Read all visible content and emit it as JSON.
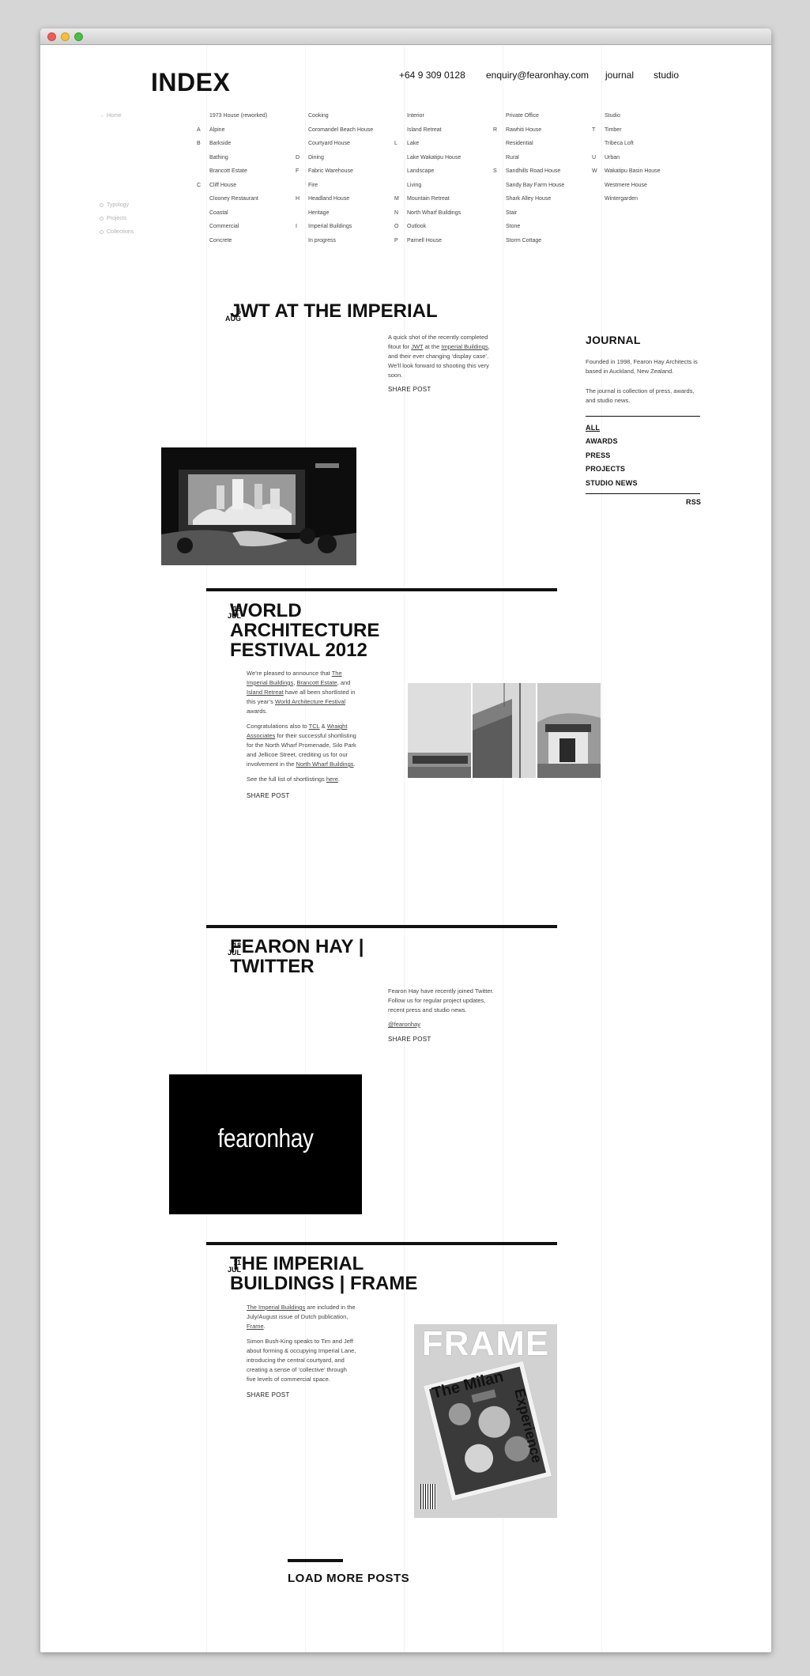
{
  "header": {
    "logo": "INDEX",
    "phone": "+64 9 309 0128",
    "email": "enquiry@fearonhay.com",
    "nav_journal": "journal",
    "nav_studio": "studio"
  },
  "sidebar": {
    "home": "Home",
    "typology": "Typology",
    "projects": "Projects",
    "collections": "Collections"
  },
  "index_columns": [
    {
      "letters": [
        "",
        "A",
        "B",
        "",
        "",
        "C",
        "",
        "",
        "",
        ""
      ],
      "items": [
        "1973 House (reworked)",
        "Alpine",
        "Barkside",
        "Bathing",
        "Brancott Estate",
        "Cliff House",
        "Clooney Restaurant",
        "Coastal",
        "Commercial",
        "Concrete"
      ]
    },
    {
      "letters": [
        "",
        "",
        "",
        "D",
        "F",
        "",
        "H",
        "",
        "I",
        ""
      ],
      "items": [
        "Cooking",
        "Coromandel Beach House",
        "Courtyard House",
        "Dining",
        "Fabric Warehouse",
        "Fire",
        "Headland House",
        "Heritage",
        "Imperial Buildings",
        "In progress"
      ]
    },
    {
      "letters": [
        "",
        "",
        "L",
        "",
        "",
        "",
        "M",
        "N",
        "O",
        "P"
      ],
      "items": [
        "Interior",
        "Island Retreat",
        "Lake",
        "Lake Wakatipu House",
        "Landscape",
        "Living",
        "Mountain Retreat",
        "North Wharf Buildings",
        "Outlook",
        "Parnell House"
      ]
    },
    {
      "letters": [
        "",
        "R",
        "",
        "",
        "S",
        "",
        "",
        "",
        "",
        ""
      ],
      "items": [
        "Private Office",
        "Rawhiti House",
        "Residential",
        "Rural",
        "Sandhills Road House",
        "Sandy Bay Farm House",
        "Shark Alley House",
        "Stair",
        "Stone",
        "Storm Cottage"
      ]
    },
    {
      "letters": [
        "",
        "T",
        "",
        "U",
        "W",
        "",
        "",
        ""
      ],
      "items": [
        "Studio",
        "Timber",
        "Tribeca Loft",
        "Urban",
        "Wakatipu Basin House",
        "Westmere House",
        "Wintergarden"
      ]
    }
  ],
  "journal": {
    "title": "JOURNAL",
    "desc1": "Founded in 1998, Fearon Hay Architects is based in Auckland, New Zealand.",
    "desc2": "The journal is collection of press, awards, and studio news.",
    "categories": [
      "ALL",
      "AWARDS",
      "PRESS",
      "PROJECTS",
      "STUDIO NEWS"
    ],
    "rss": "RSS"
  },
  "posts": [
    {
      "day": "5",
      "month": "AUG",
      "title": "JWT AT THE IMPERIAL",
      "body_a": "A quick shot of the recently completed fitout for ",
      "link_a": "JWT",
      "body_b": " at the ",
      "link_b": "Imperial Buildings",
      "body_c": ", and their ever changing ‘display case’. We’ll look forward to shooting this very soon.",
      "share": "SHARE POST"
    },
    {
      "day": "18",
      "month": "JUL",
      "title_lines": [
        "WORLD",
        "ARCHITECTURE",
        "FESTIVAL 2012"
      ],
      "p1_a": "We’re pleased to announce that ",
      "p1_l1": "The Imperial Buildings",
      "p1_b": ", ",
      "p1_l2": "Brancott Estate",
      "p1_c": ", and ",
      "p1_l3": "Island Retreat",
      "p1_d": " have all been shortlisted in this year’s ",
      "p1_l4": "World Architecture Festival",
      "p1_e": " awards.",
      "p2_a": "Congratulations also to ",
      "p2_l1": "TCL",
      "p2_b": " & ",
      "p2_l2": "Wraight Associates",
      "p2_c": " for their successful shortlisting for the North Wharf Promenade, Silo Park and Jellicoe Street, crediting us for our involvement in the ",
      "p2_l3": "North Wharf Buildings",
      "p2_d": ".",
      "p3_a": "See the full list of shortlistings ",
      "p3_l1": "here",
      "p3_b": ".",
      "share": "SHARE POST"
    },
    {
      "day": "18",
      "month": "JUL",
      "title_lines": [
        "FEARON HAY |",
        "TWITTER"
      ],
      "body": "Fearon Hay have recently joined Twitter. Follow us for regular project updates, recent press and studio news.",
      "handle": "@fearonhay",
      "share": "SHARE POST",
      "image_wordmark": "fearonhay"
    },
    {
      "day": "11",
      "month": "JUL",
      "title_lines": [
        "THE IMPERIAL",
        "BUILDINGS | FRAME"
      ],
      "p1_l1": "The Imperial Buildings",
      "p1_a": " are included in the July/August issue of Dutch publication, ",
      "p1_l2": "Frame",
      "p1_b": ".",
      "p2": "Simon Bush-King speaks to Tim and Jeff about forming & occupying Imperial Lane, introducing the central courtyard, and creating a sense of ‘collective’ through five levels of commercial space.",
      "share": "SHARE POST",
      "mag_title": "FRAME",
      "mag_cover_1": "The Milan",
      "mag_cover_2": "Experience"
    }
  ],
  "load_more": "LOAD MORE POSTS"
}
